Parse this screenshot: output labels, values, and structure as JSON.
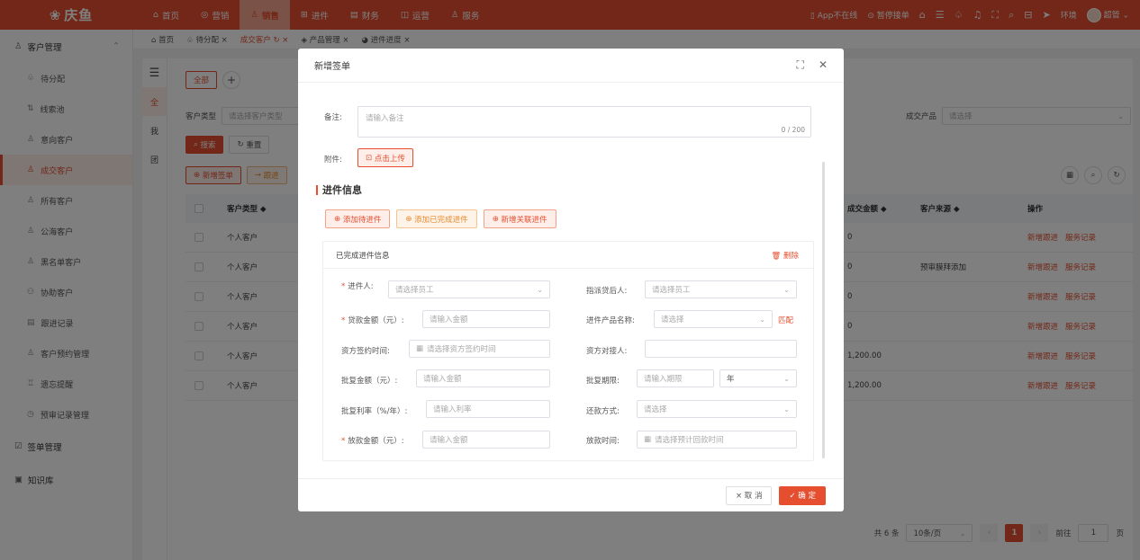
{
  "app": {
    "logo": "庆鱼"
  },
  "topnav": [
    {
      "icon": "⌂",
      "label": "首页"
    },
    {
      "icon": "◎",
      "label": "营销"
    },
    {
      "icon": "♙",
      "label": "销售"
    },
    {
      "icon": "⊞",
      "label": "进件"
    },
    {
      "icon": "▤",
      "label": "财务"
    },
    {
      "icon": "◫",
      "label": "运营"
    },
    {
      "icon": "♙",
      "label": "服务"
    }
  ],
  "topright": {
    "app_status": "App不在线",
    "pause_status": "暂停接单",
    "env": "环境",
    "user": "超管"
  },
  "sidebar": {
    "group_customer": "客户管理",
    "items": [
      "待分配",
      "线索池",
      "意向客户",
      "成交客户",
      "所有客户",
      "公海客户",
      "黑名单客户",
      "协助客户",
      "跟进记录",
      "客户预约管理",
      "遗忘提醒",
      "预审记录管理"
    ],
    "group_sign": "签单管理",
    "group_kb": "知识库"
  },
  "tags": [
    "首页",
    "待分配 ×",
    "成交客户 ↻ ×",
    "产品管理 ×",
    "进件进度 ×"
  ],
  "sidetabs": [
    "全",
    "我",
    "团"
  ],
  "filters": {
    "tab_all": "全部",
    "customer_type_label": "客户类型",
    "customer_type_placeholder": "请选择客户类型",
    "deal_product_label": "成交产品",
    "deal_product_placeholder": "请选择",
    "search": "搜索",
    "reset": "重置"
  },
  "actions": {
    "new_sign": "新增签单",
    "follow": "跟进"
  },
  "table": {
    "headers": {
      "type": "客户类型 ◆",
      "amount": "成交金额 ◆",
      "source": "客户来源 ◆",
      "ops": "操作"
    },
    "rows": [
      {
        "type": "个人客户",
        "amount": "0",
        "source": ""
      },
      {
        "type": "个人客户",
        "amount": "0",
        "source": "预审膜拜添加"
      },
      {
        "type": "个人客户",
        "amount": "0",
        "source": ""
      },
      {
        "type": "个人客户",
        "amount": "0",
        "source": ""
      },
      {
        "type": "个人客户",
        "amount": "1,200.00",
        "source": ""
      },
      {
        "type": "个人客户",
        "amount": "1,200.00",
        "source": ""
      }
    ],
    "op1": "新增跟进",
    "op2": "服务记录"
  },
  "pager": {
    "total": "共 6 条",
    "page_size": "10条/页",
    "current": "1",
    "goto": "前往",
    "goto_value": "1",
    "page_unit": "页"
  },
  "modal": {
    "title": "新增签单",
    "remark_label": "备注:",
    "remark_placeholder": "请输入备注",
    "remark_count": "0 / 200",
    "attach_label": "附件:",
    "upload": "点击上传",
    "section": "进件信息",
    "btn_add_pending": "添加待进件",
    "btn_add_done": "添加已完成进件",
    "btn_add_linked": "新增关联进件",
    "card_title": "已完成进件信息",
    "delete": "删除",
    "f_applicant": "进件人:",
    "f_applicant_ph": "请选择员工",
    "f_post_loan": "指派贷后人:",
    "f_post_loan_ph": "请选择员工",
    "f_loan_amount": "贷款金额（元）:",
    "f_loan_amount_ph": "请输入金额",
    "f_product": "进件产品名称:",
    "f_product_ph": "请选择",
    "f_match": "匹配",
    "f_sign_time": "资方签约时间:",
    "f_sign_time_ph": "请选择资方签约时间",
    "f_contact": "资方对接人:",
    "f_approve_amount": "批复金额（元）:",
    "f_approve_amount_ph": "请输入金额",
    "f_approve_term": "批复期限:",
    "f_approve_term_ph": "请输入期限",
    "f_term_unit": "年",
    "f_rate": "批复利率（%/年）:",
    "f_rate_ph": "请输入利率",
    "f_repay": "还款方式:",
    "f_repay_ph": "请选择",
    "f_disburse": "放款金额（元）:",
    "f_disburse_ph": "请输入金额",
    "f_disburse_time": "放款时间:",
    "f_disburse_time_ph": "请选择预计回款时间",
    "cancel": "× 取 消",
    "confirm": "✓ 确 定"
  }
}
